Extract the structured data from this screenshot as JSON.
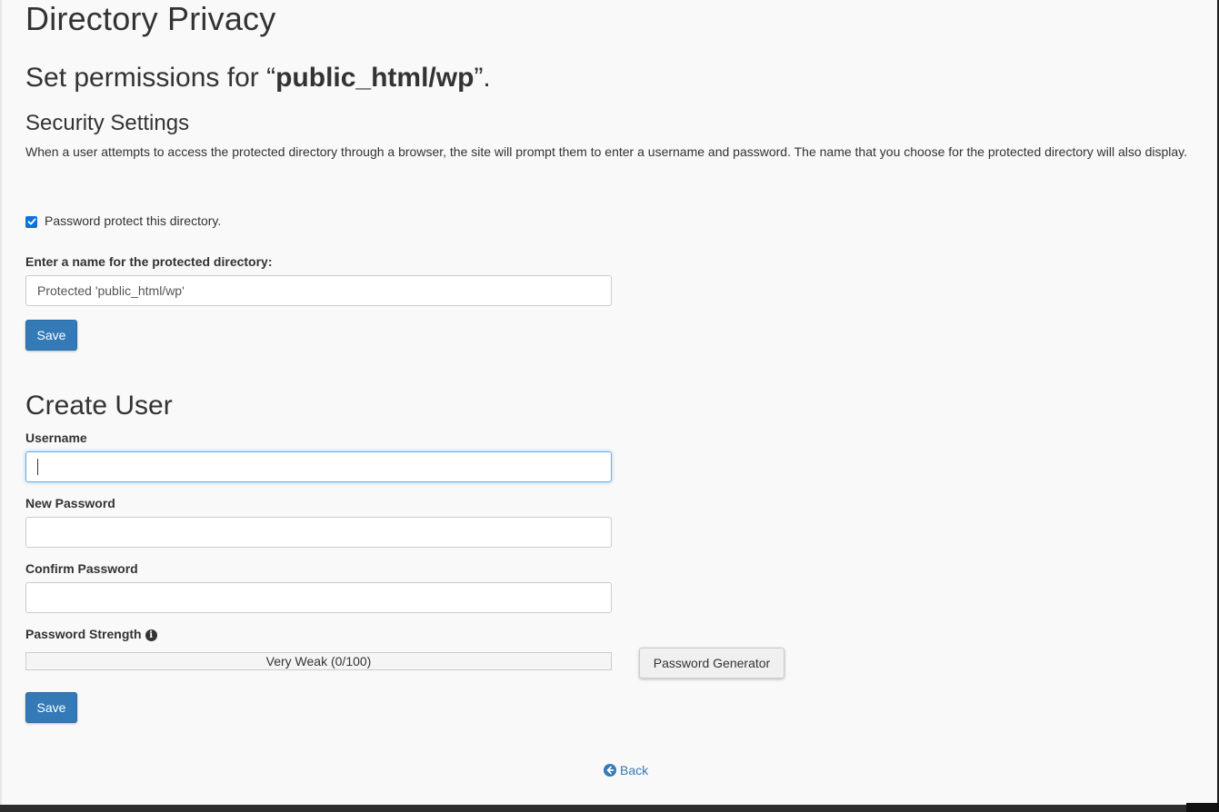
{
  "page": {
    "title": "Directory Privacy",
    "permissions_prefix": "Set permissions for “",
    "directory_path": "public_html/wp",
    "permissions_suffix": "”."
  },
  "security": {
    "heading": "Security Settings",
    "description": "When a user attempts to access the protected directory through a browser, the site will prompt them to enter a username and password. The name that you choose for the protected directory will also display.",
    "protect_checkbox_label": "Password protect this directory.",
    "protect_checked": true,
    "name_label": "Enter a name for the protected directory:",
    "name_value": "Protected 'public_html/wp'",
    "save_label": "Save"
  },
  "create_user": {
    "heading": "Create User",
    "username_label": "Username",
    "username_value": "",
    "new_password_label": "New Password",
    "new_password_value": "",
    "confirm_password_label": "Confirm Password",
    "confirm_password_value": "",
    "strength_label": "Password Strength",
    "strength_text": "Very Weak (0/100)",
    "strength_score": 0,
    "generator_label": "Password Generator",
    "save_label": "Save"
  },
  "footer": {
    "back_label": "Back"
  },
  "icons": {
    "info": "info-circle-icon",
    "back": "arrow-circle-left-icon",
    "checkbox": "checkmark-icon"
  },
  "colors": {
    "primary": "#337ab7",
    "checkbox": "#0a74da",
    "focus_border": "#66afe9"
  }
}
